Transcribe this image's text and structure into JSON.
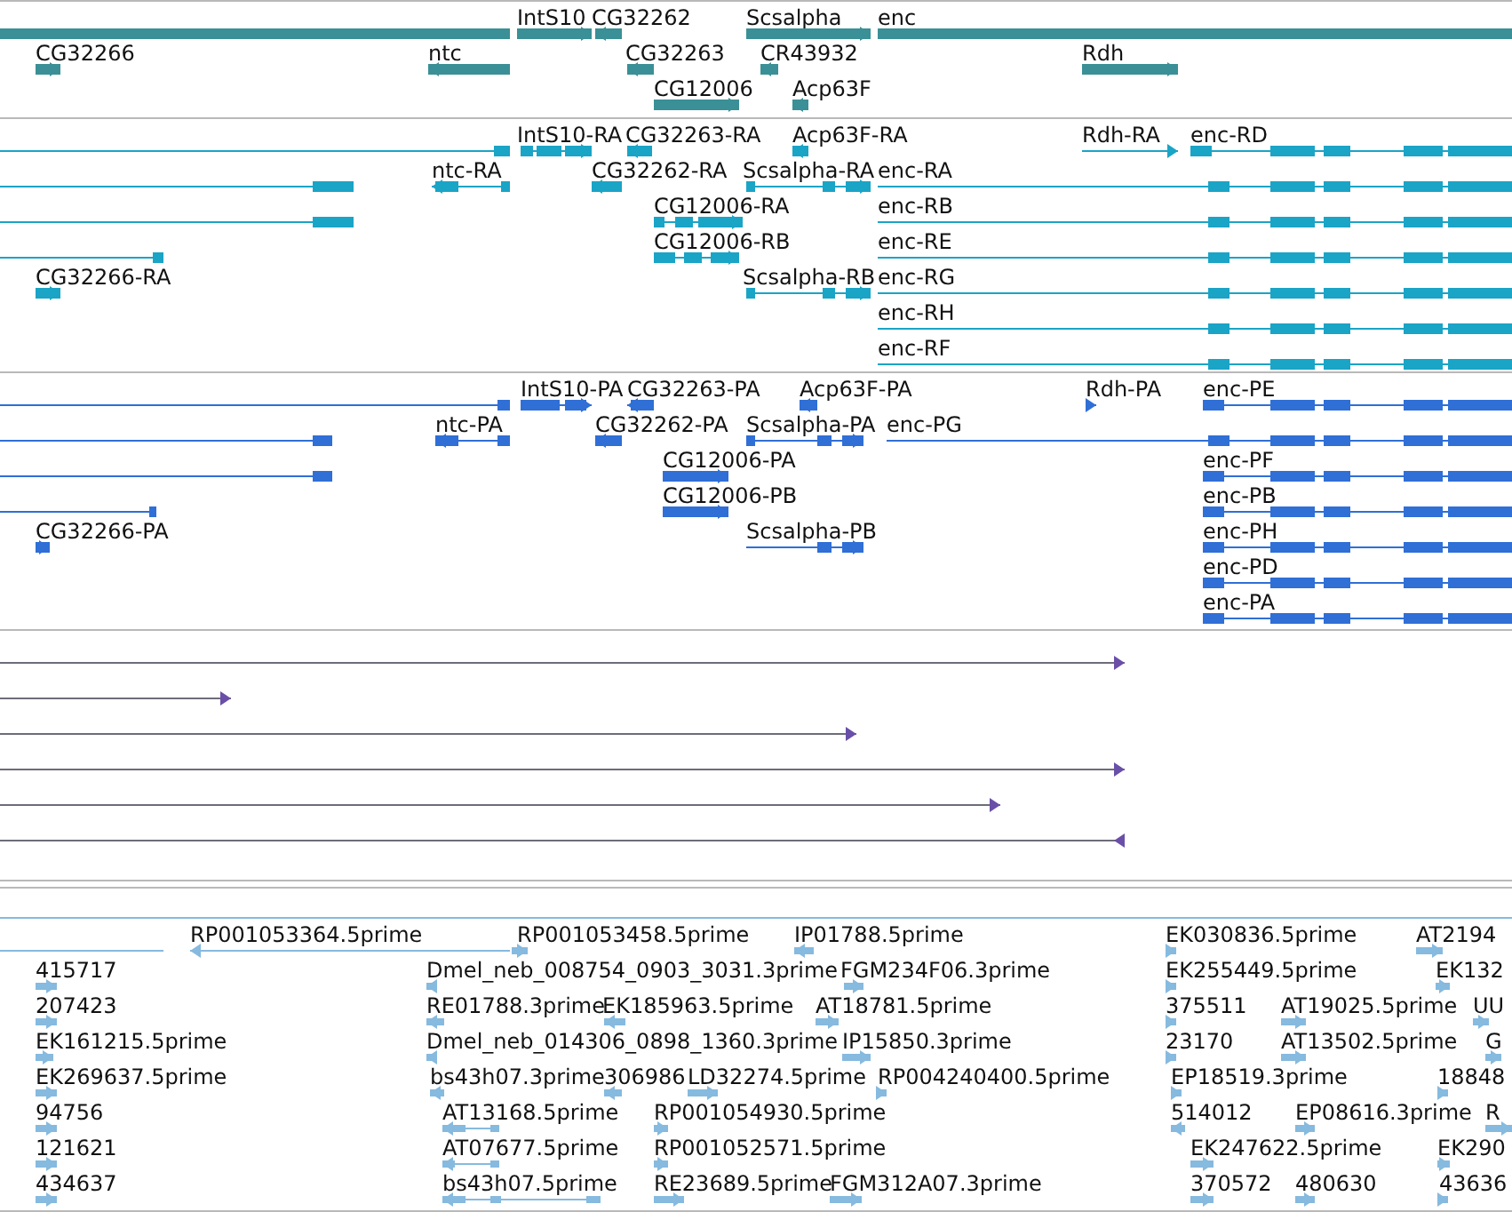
{
  "tracks": [
    {
      "kind": "gene",
      "features": [
        {
          "forward": false
        },
        {
          "label": "IntS10",
          "forward": true
        },
        {
          "label": "CG32262",
          "forward": false
        },
        {
          "label": "Scsalpha",
          "forward": true
        },
        {
          "label": "enc",
          "forward": true
        },
        {
          "label": "CG32266",
          "forward": true
        },
        {
          "label": "ntc",
          "forward": false
        },
        {
          "label": "CG32263",
          "forward": false
        },
        {
          "label": "CR43932",
          "forward": false
        },
        {
          "label": "Rdh",
          "forward": true
        },
        {
          "label": "CG12006",
          "forward": true
        },
        {
          "label": "Acp63F",
          "forward": false
        }
      ]
    },
    {
      "kind": "transcript",
      "features": [
        {
          "forward": false
        },
        {
          "label": "IntS10-RA",
          "forward": true
        },
        {
          "label": "CG32263-RA",
          "forward": false
        },
        {
          "label": "Acp63F-RA",
          "forward": false
        },
        {
          "label": "Rdh-RA",
          "forward": true
        },
        {
          "label": "enc-RD",
          "forward": true
        },
        {
          "forward": false
        },
        {
          "label": "ntc-RA",
          "forward": false
        },
        {
          "label": "CG32262-RA",
          "forward": false
        },
        {
          "label": "Scsalpha-RA",
          "forward": true
        },
        {
          "label": "enc-RA",
          "forward": true
        },
        {
          "forward": false
        },
        {
          "label": "CG12006-RA",
          "forward": true
        },
        {
          "label": "enc-RB",
          "forward": true
        },
        {
          "forward": false
        },
        {
          "label": "CG12006-RB",
          "forward": true
        },
        {
          "label": "enc-RE",
          "forward": true
        },
        {
          "label": "CG32266-RA",
          "forward": true
        },
        {
          "label": "Scsalpha-RB",
          "forward": true
        },
        {
          "label": "enc-RG",
          "forward": true
        },
        {
          "label": "enc-RH",
          "forward": true
        },
        {
          "label": "enc-RF",
          "forward": true
        }
      ]
    },
    {
      "kind": "protein",
      "features": [
        {
          "forward": false
        },
        {
          "label": "IntS10-PA",
          "forward": true
        },
        {
          "label": "CG32263-PA",
          "forward": false
        },
        {
          "label": "Acp63F-PA",
          "forward": false
        },
        {
          "label": "Rdh-PA",
          "forward": true
        },
        {
          "label": "enc-PE",
          "forward": true
        },
        {
          "forward": false
        },
        {
          "label": "ntc-PA",
          "forward": false
        },
        {
          "label": "CG32262-PA",
          "forward": false
        },
        {
          "label": "Scsalpha-PA",
          "forward": true
        },
        {
          "label": "enc-PG",
          "forward": true
        },
        {
          "forward": false
        },
        {
          "label": "CG12006-PA",
          "forward": true
        },
        {
          "label": "enc-PF",
          "forward": true
        },
        {
          "forward": false
        },
        {
          "label": "CG12006-PB",
          "forward": true
        },
        {
          "label": "enc-PB",
          "forward": true
        },
        {
          "label": "CG32266-PA",
          "forward": true
        },
        {
          "label": "Scsalpha-PB",
          "forward": true
        },
        {
          "label": "enc-PH",
          "forward": true
        },
        {
          "label": "enc-PD",
          "forward": true
        },
        {
          "label": "enc-PA",
          "forward": true
        }
      ]
    },
    {
      "kind": "alignment",
      "features": [
        {
          "forward": true
        },
        {
          "forward": true
        },
        {
          "forward": true
        },
        {
          "forward": true
        },
        {
          "forward": true
        },
        {
          "forward": false
        }
      ]
    },
    {
      "kind": "est",
      "features": [
        {
          "forward": false
        },
        {
          "label": "RP001053364.5prime",
          "forward": false
        },
        {
          "label": "RP001053458.5prime",
          "forward": true
        },
        {
          "label": "IP01788.5prime",
          "forward": false
        },
        {
          "label": "EK030836.5prime",
          "forward": true
        },
        {
          "label": "AT2194",
          "forward": true
        },
        {
          "label": "415717",
          "forward": true
        },
        {
          "label": "Dmel_neb_008754_0903_3031.3prime",
          "forward": false
        },
        {
          "label": "FGM234F06.3prime",
          "forward": true
        },
        {
          "label": "EK255449.5prime",
          "forward": true
        },
        {
          "label": "EK132",
          "forward": true
        },
        {
          "label": "207423",
          "forward": true
        },
        {
          "label": "RE01788.3prime",
          "forward": false
        },
        {
          "label": "EK185963.5prime",
          "forward": false
        },
        {
          "label": "AT18781.5prime",
          "forward": true
        },
        {
          "label": "375511",
          "forward": true
        },
        {
          "label": "AT19025.5prime",
          "forward": true
        },
        {
          "label": "UU",
          "forward": true
        },
        {
          "label": "EK161215.5prime",
          "forward": true
        },
        {
          "label": "Dmel_neb_014306_0898_1360.3prime",
          "forward": false
        },
        {
          "label": "IP15850.3prime",
          "forward": true
        },
        {
          "label": "23170",
          "forward": true
        },
        {
          "label": "AT13502.5prime",
          "forward": true
        },
        {
          "label": "G",
          "forward": true
        },
        {
          "label": "EK269637.5prime",
          "forward": true
        },
        {
          "label": "bs43h07.3prime",
          "forward": false
        },
        {
          "label": "306986",
          "forward": false
        },
        {
          "label": "LD32274.5prime",
          "forward": true
        },
        {
          "label": "RP004240400.5prime",
          "forward": true
        },
        {
          "label": "EP18519.3prime",
          "forward": true
        },
        {
          "label": "18848",
          "forward": true
        },
        {
          "label": "94756",
          "forward": true
        },
        {
          "label": "AT13168.5prime",
          "forward": false
        },
        {
          "label": "RP001054930.5prime",
          "forward": true
        },
        {
          "label": "514012",
          "forward": false
        },
        {
          "label": "EP08616.3prime",
          "forward": true
        },
        {
          "label": "R",
          "forward": true
        },
        {
          "label": "121621",
          "forward": true
        },
        {
          "label": "AT07677.5prime",
          "forward": false
        },
        {
          "label": "RP001052571.5prime",
          "forward": true
        },
        {
          "label": "EK247622.5prime",
          "forward": true
        },
        {
          "label": "EK290",
          "forward": true
        },
        {
          "label": "434637",
          "forward": true
        },
        {
          "label": "bs43h07.5prime",
          "forward": false
        },
        {
          "label": "RE23689.5prime",
          "forward": true
        },
        {
          "label": "FGM312A07.3prime",
          "forward": true
        },
        {
          "label": "370572",
          "forward": true
        },
        {
          "label": "480630",
          "forward": true
        },
        {
          "label": "43636",
          "forward": true
        }
      ]
    }
  ]
}
